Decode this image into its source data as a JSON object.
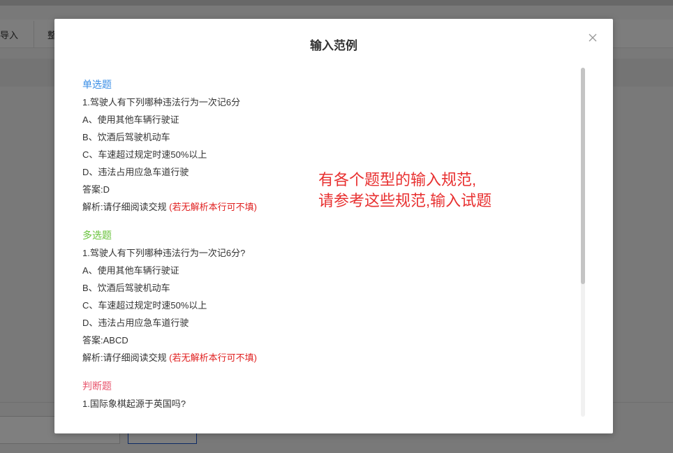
{
  "background": {
    "toolbar_tabs": [
      "导入",
      "整"
    ]
  },
  "modal": {
    "title": "输入范例",
    "close_icon": "close-icon",
    "sections": [
      {
        "title": "单选题",
        "title_color": "#3a8ee6",
        "question": "1.驾驶人有下列哪种违法行为一次记6分",
        "options": [
          "A、使用其他车辆行驶证",
          "B、饮酒后驾驶机动车",
          "C、车速超过规定时速50%以上",
          "D、违法占用应急车道行驶"
        ],
        "answer": "答案:D",
        "analysis": "解析:请仔细阅读交规",
        "analysis_note": "(若无解析本行可不填)"
      },
      {
        "title": "多选题",
        "title_color": "#67c23a",
        "question": "1.驾驶人有下列哪种违法行为一次记6分?",
        "options": [
          "A、使用其他车辆行驶证",
          "B、饮酒后驾驶机动车",
          "C、车速超过规定时速50%以上",
          "D、违法占用应急车道行驶"
        ],
        "answer": "答案:ABCD",
        "analysis": "解析:请仔细阅读交规",
        "analysis_note": "(若无解析本行可不填)"
      },
      {
        "title": "判断题",
        "title_color": "#e8556d",
        "question": "1.国际象棋起源于英国吗?"
      }
    ],
    "annotation": {
      "line1": "有各个题型的输入规范,",
      "line2": "请参考这些规范,输入试题",
      "color": "#e83030"
    }
  }
}
